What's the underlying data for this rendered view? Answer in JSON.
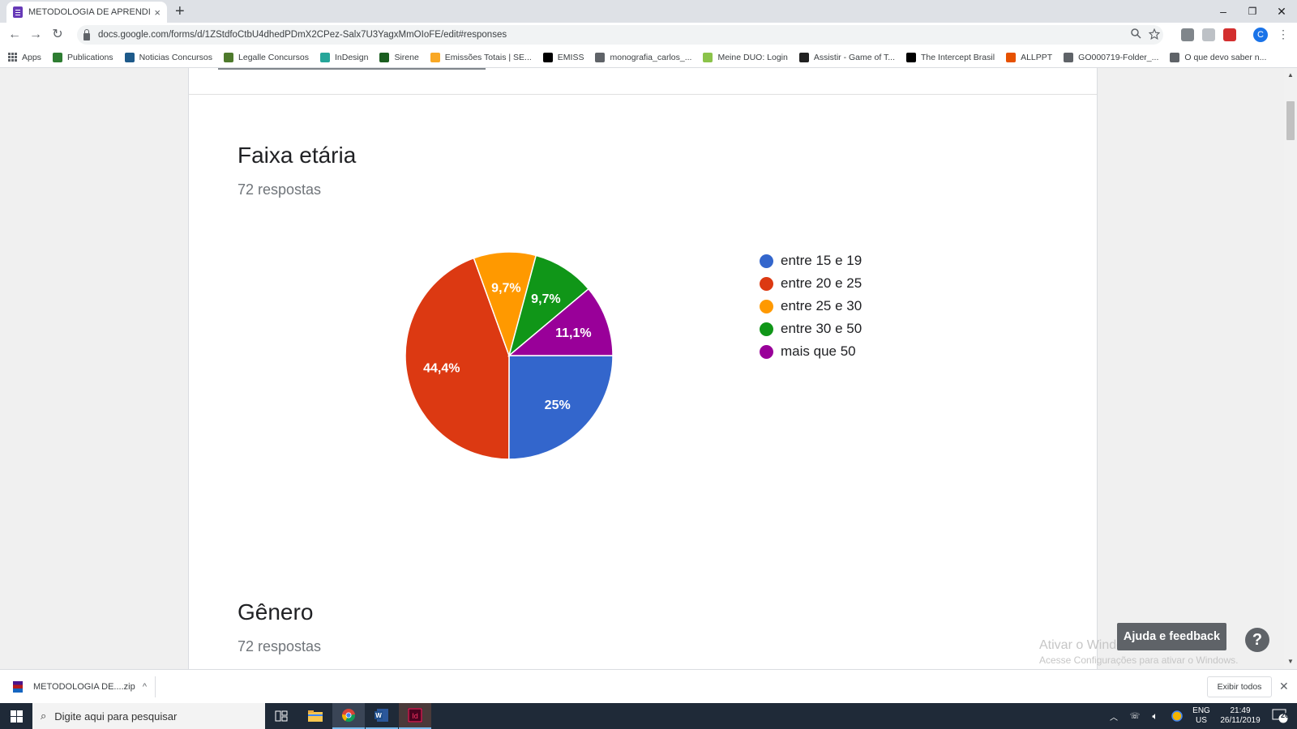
{
  "browser": {
    "tab_title": "METODOLOGIA DE APRENDIZAGE",
    "tab_close": "×",
    "new_tab": "+",
    "url": "docs.google.com/forms/d/1ZStdfoCtbU4dhedPDmX2CPez-Salx7U3YagxMmOIoFE/edit#responses",
    "window_controls": {
      "minimize": "–",
      "restore": "❐",
      "close": "✕"
    },
    "nav": {
      "back": "←",
      "forward": "→",
      "reload": "↻"
    },
    "profile_initial": "C",
    "bookmarks": [
      {
        "label": "Apps",
        "color": "#5f6368"
      },
      {
        "label": "Publications",
        "color": "#2e7d32"
      },
      {
        "label": "Noticias Concursos",
        "color": "#1e5a8a"
      },
      {
        "label": "Legalle Concursos",
        "color": "#4e7a2c"
      },
      {
        "label": "InDesign",
        "color": "#26a69a"
      },
      {
        "label": "Sirene",
        "color": "#1b5e20"
      },
      {
        "label": "Emissões Totais | SE...",
        "color": "#f9a825"
      },
      {
        "label": "EMISS",
        "color": "#000000"
      },
      {
        "label": "monografia_carlos_...",
        "color": "#5f6368"
      },
      {
        "label": "Meine DUO: Login",
        "color": "#8bc34a"
      },
      {
        "label": "Assistir - Game of T...",
        "color": "#212121"
      },
      {
        "label": "The Intercept Brasil",
        "color": "#000000"
      },
      {
        "label": "ALLPPT",
        "color": "#e65100"
      },
      {
        "label": "GO000719-Folder_...",
        "color": "#5f6368"
      },
      {
        "label": "O que devo saber n...",
        "color": "#5f6368"
      }
    ]
  },
  "form": {
    "q1_title": "Faixa etária",
    "q1_count": "72 respostas",
    "q2_title": "Gênero",
    "q2_count": "72 respostas"
  },
  "chart_data": {
    "type": "pie",
    "categories": [
      "entre 15 e 19",
      "entre 20 e 25",
      "entre 25 e 30",
      "entre 30 e 50",
      "mais que 50"
    ],
    "values": [
      25,
      44.4,
      9.7,
      9.7,
      11.1
    ],
    "labels": [
      "25%",
      "44,4%",
      "9,7%",
      "9,7%",
      "11,1%"
    ],
    "colors": [
      "#3366cc",
      "#dc3912",
      "#ff9900",
      "#109618",
      "#990099"
    ],
    "legend_position": "right",
    "start": "3 o'clock, clockwise"
  },
  "overlay": {
    "feedback": "Ajuda e feedback",
    "help": "?",
    "watermark_title": "Ativar o Windows",
    "watermark_sub": "Acesse Configurações para ativar o Windows."
  },
  "downloads": {
    "file": "METODOLOGIA DE....zip",
    "chevron": "^",
    "show_all": "Exibir todos",
    "close": "✕"
  },
  "taskbar": {
    "search_placeholder": "Digite aqui para pesquisar",
    "lang_top": "ENG",
    "lang_bottom": "US",
    "time": "21:49",
    "date": "26/11/2019",
    "notifications": "20"
  }
}
